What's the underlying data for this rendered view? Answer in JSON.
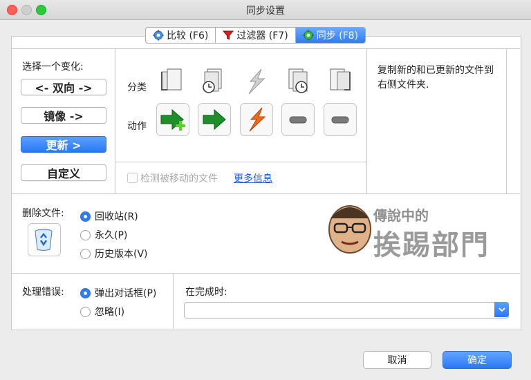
{
  "window": {
    "title": "同步设置"
  },
  "tabs": [
    {
      "label": "比较 (F6)"
    },
    {
      "label": "过滤器 (F7)"
    },
    {
      "label": "同步 (F8)"
    }
  ],
  "variants": {
    "heading": "选择一个变化:",
    "buttons": [
      "<- 双向 ->",
      "镜像 ->",
      "更新 >",
      "自定义"
    ],
    "selected": "更新 >"
  },
  "matrix": {
    "category_label": "分类",
    "action_label": "动作",
    "category_icons": [
      "left-only-file-icon",
      "left-newer-file-icon",
      "conflict-icon",
      "right-newer-file-icon",
      "right-only-file-icon"
    ],
    "action_icons": [
      "copy-new-right-icon",
      "copy-right-icon",
      "conflict-action-icon",
      "do-nothing-icon",
      "do-nothing-icon"
    ],
    "detect_moved_label": "检测被移动的文件",
    "more_info_link": "更多信息"
  },
  "description": "复制新的和已更新的文件到右侧文件夹.",
  "delete_files": {
    "label": "删除文件:",
    "options": [
      "回收站(R)",
      "永久(P)",
      "历史版本(V)"
    ],
    "selected": "回收站(R)"
  },
  "errors": {
    "label": "处理错误:",
    "options": [
      "弹出对话框(P)",
      "忽略(I)"
    ],
    "selected": "弹出对话框(P)"
  },
  "on_completion": {
    "label": "在完成时:",
    "value": ""
  },
  "footer": {
    "cancel": "取消",
    "ok": "确定"
  },
  "watermark": {
    "line1": "傳說中的",
    "line2": "挨踢部門"
  },
  "colors": {
    "accent": "#2e7cf6",
    "link": "#1b56d6"
  }
}
